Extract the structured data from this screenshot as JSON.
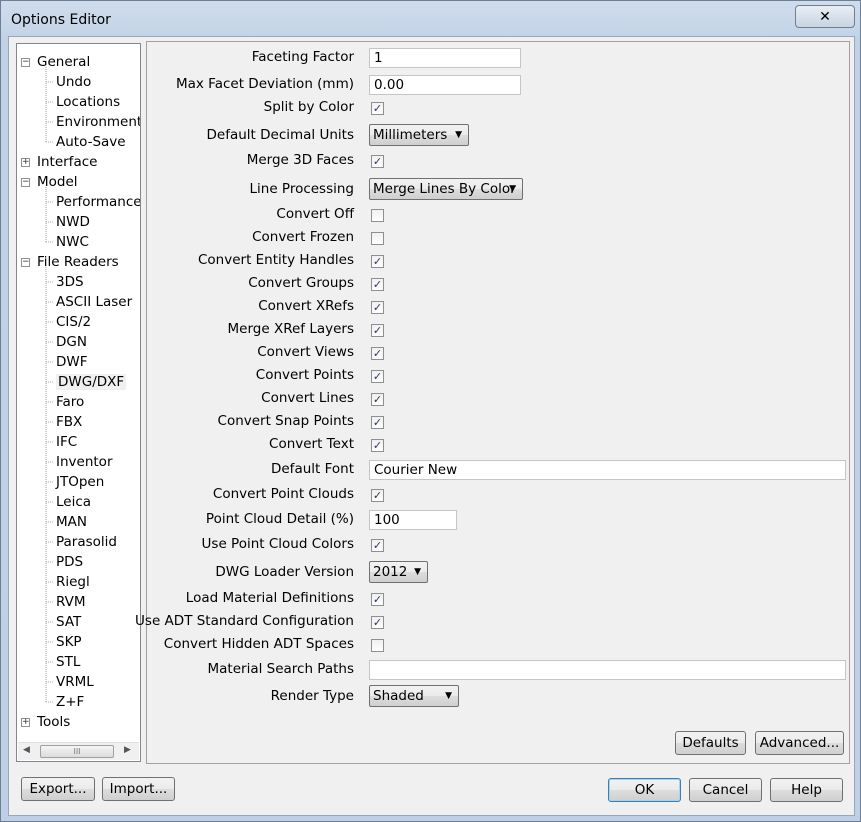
{
  "window": {
    "title": "Options Editor"
  },
  "tree": {
    "items": [
      {
        "label": "General",
        "level": 0,
        "toggle": "minus"
      },
      {
        "label": "Undo",
        "level": 1
      },
      {
        "label": "Locations",
        "level": 1
      },
      {
        "label": "Environment",
        "level": 1
      },
      {
        "label": "Auto-Save",
        "level": 1
      },
      {
        "label": "Interface",
        "level": 0,
        "toggle": "plus"
      },
      {
        "label": "Model",
        "level": 0,
        "toggle": "minus"
      },
      {
        "label": "Performance",
        "level": 1
      },
      {
        "label": "NWD",
        "level": 1
      },
      {
        "label": "NWC",
        "level": 1
      },
      {
        "label": "File Readers",
        "level": 0,
        "toggle": "minus"
      },
      {
        "label": "3DS",
        "level": 1
      },
      {
        "label": "ASCII Laser",
        "level": 1
      },
      {
        "label": "CIS/2",
        "level": 1
      },
      {
        "label": "DGN",
        "level": 1
      },
      {
        "label": "DWF",
        "level": 1
      },
      {
        "label": "DWG/DXF",
        "level": 1,
        "selected": true
      },
      {
        "label": "Faro",
        "level": 1
      },
      {
        "label": "FBX",
        "level": 1
      },
      {
        "label": "IFC",
        "level": 1
      },
      {
        "label": "Inventor",
        "level": 1
      },
      {
        "label": "JTOpen",
        "level": 1
      },
      {
        "label": "Leica",
        "level": 1
      },
      {
        "label": "MAN",
        "level": 1
      },
      {
        "label": "Parasolid",
        "level": 1
      },
      {
        "label": "PDS",
        "level": 1
      },
      {
        "label": "Riegl",
        "level": 1
      },
      {
        "label": "RVM",
        "level": 1
      },
      {
        "label": "SAT",
        "level": 1
      },
      {
        "label": "SKP",
        "level": 1
      },
      {
        "label": "STL",
        "level": 1
      },
      {
        "label": "VRML",
        "level": 1
      },
      {
        "label": "Z+F",
        "level": 1
      },
      {
        "label": "Tools",
        "level": 0,
        "toggle": "plus"
      }
    ],
    "scroll_thumb_glyph": "III"
  },
  "options": [
    {
      "label": "Faceting Factor",
      "type": "text",
      "value": "1"
    },
    {
      "label": "Max Facet Deviation (mm)",
      "type": "text",
      "value": "0.00"
    },
    {
      "label": "Split by Color",
      "type": "checkbox",
      "checked": true
    },
    {
      "label": "Default Decimal Units",
      "type": "combo",
      "value": "Millimeters"
    },
    {
      "label": "Merge 3D Faces",
      "type": "checkbox",
      "checked": true
    },
    {
      "label": "Line Processing",
      "type": "combo",
      "value": "Merge Lines By Color"
    },
    {
      "label": "Convert Off",
      "type": "checkbox",
      "checked": false
    },
    {
      "label": "Convert Frozen",
      "type": "checkbox",
      "checked": false
    },
    {
      "label": "Convert Entity Handles",
      "type": "checkbox",
      "checked": true
    },
    {
      "label": "Convert Groups",
      "type": "checkbox",
      "checked": true
    },
    {
      "label": "Convert XRefs",
      "type": "checkbox",
      "checked": true
    },
    {
      "label": "Merge XRef Layers",
      "type": "checkbox",
      "checked": true
    },
    {
      "label": "Convert Views",
      "type": "checkbox",
      "checked": true
    },
    {
      "label": "Convert Points",
      "type": "checkbox",
      "checked": true
    },
    {
      "label": "Convert Lines",
      "type": "checkbox",
      "checked": true
    },
    {
      "label": "Convert Snap Points",
      "type": "checkbox",
      "checked": true
    },
    {
      "label": "Convert Text",
      "type": "checkbox",
      "checked": true
    },
    {
      "label": "Default Font",
      "type": "text",
      "value": "Courier New"
    },
    {
      "label": "Convert Point Clouds",
      "type": "checkbox",
      "checked": true
    },
    {
      "label": "Point Cloud Detail (%)",
      "type": "text",
      "value": "100"
    },
    {
      "label": "Use Point Cloud Colors",
      "type": "checkbox",
      "checked": true
    },
    {
      "label": "DWG Loader Version",
      "type": "combo",
      "value": "2012"
    },
    {
      "label": "Load Material Definitions",
      "type": "checkbox",
      "checked": true
    },
    {
      "label": "Use ADT Standard Configuration",
      "type": "checkbox",
      "checked": true
    },
    {
      "label": "Convert Hidden ADT Spaces",
      "type": "checkbox",
      "checked": false
    },
    {
      "label": "Material Search Paths",
      "type": "text",
      "value": ""
    },
    {
      "label": "Render Type",
      "type": "combo",
      "value": "Shaded"
    }
  ],
  "panel_buttons": {
    "defaults": "Defaults",
    "advanced": "Advanced..."
  },
  "footer_buttons": {
    "export": "Export...",
    "import": "Import...",
    "ok": "OK",
    "cancel": "Cancel",
    "help": "Help"
  },
  "glyphs": {
    "check": "✓",
    "dropdown": "▼",
    "close": "✕",
    "minus": "−",
    "plus": "+",
    "scroll_left": "◀",
    "scroll_right": "▶"
  }
}
